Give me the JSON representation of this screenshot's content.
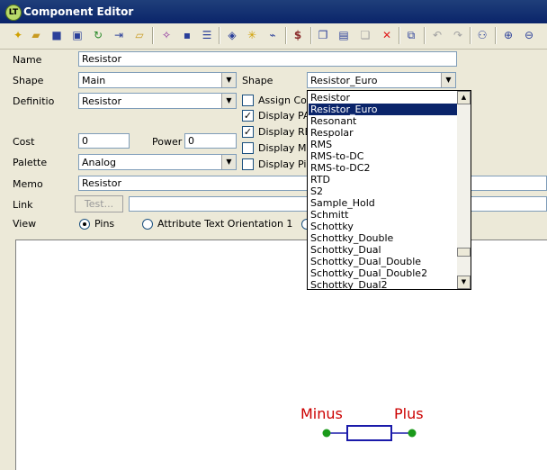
{
  "window": {
    "title": "Component Editor",
    "app_icon": "app-icon-badge",
    "app_icon_text": "LT"
  },
  "toolbar": {
    "icons": [
      "new-icon",
      "open-icon",
      "save-icon",
      "save-as-icon",
      "refresh-icon",
      "import-icon",
      "export-icon",
      "wand-icon",
      "save-symbol-icon",
      "list-icon",
      "shapes-icon",
      "sparkle-icon",
      "wire-icon",
      "dollar-icon",
      "copy-icon",
      "paste-icon",
      "duplicate-icon",
      "delete-icon",
      "replace-icon",
      "undo-icon",
      "redo-icon",
      "binoculars-icon",
      "zoom-in-icon",
      "zoom-out-icon"
    ]
  },
  "form": {
    "name_label": "Name",
    "name_value": "Resistor",
    "shape_label": "Shape",
    "shape_value": "Main",
    "shape2_label": "Shape",
    "shape2_value": "Resistor_Euro",
    "definition_label": "Definitio",
    "definition_value": "Resistor",
    "assign_label": "Assign Co",
    "display_pa_label": "Display PA",
    "display_re_label": "Display RE",
    "display_mo_label": "Display MC",
    "display_pi_label": "Display Pir",
    "cost_label": "Cost",
    "cost_value": "0",
    "power_label": "Power",
    "power_value": "0",
    "palette_label": "Palette",
    "palette_value": "Analog",
    "memo_label": "Memo",
    "memo_value": "Resistor",
    "link_label": "Link",
    "test_button": "Test...",
    "link_value": "",
    "view_label": "View",
    "view_pins": "Pins",
    "view_attr": "Attribute Text Orientation 1"
  },
  "dropdown": {
    "items": [
      "Resistor",
      "Resistor_Euro",
      "Resonant",
      "Respolar",
      "RMS",
      "RMS-to-DC",
      "RMS-to-DC2",
      "RTD",
      "S2",
      "Sample_Hold",
      "Schmitt",
      "Schottky",
      "Schottky_Double",
      "Schottky_Dual",
      "Schottky_Dual_Double",
      "Schottky_Dual_Double2",
      "Schottky_Dual2"
    ],
    "selected_index": 1
  },
  "symbol": {
    "left_label": "Minus",
    "right_label": "Plus",
    "label_color": "#cc0000",
    "body_color": "#1a1aaa",
    "pin_color": "#1a9a1a"
  }
}
